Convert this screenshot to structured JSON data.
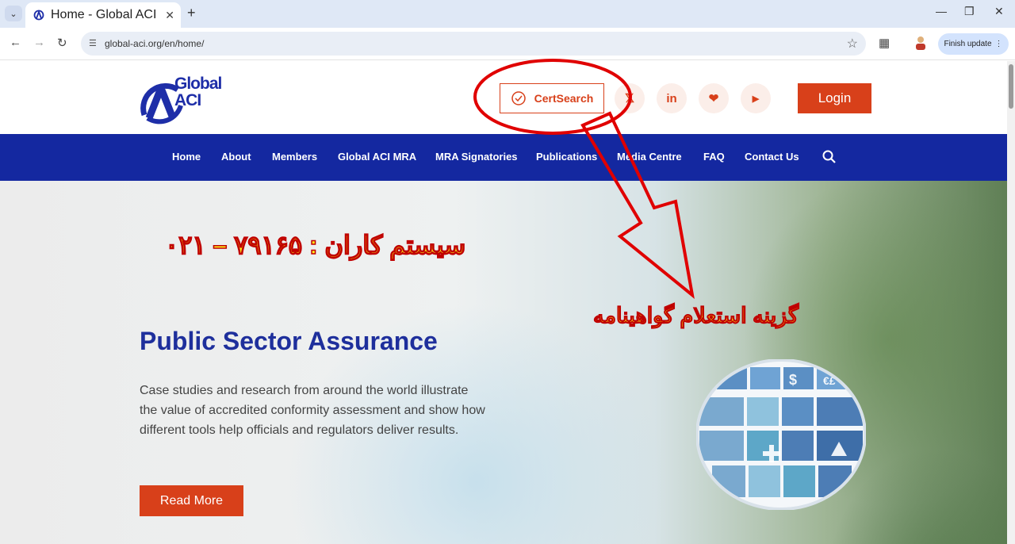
{
  "browser": {
    "tab_title": "Home - Global ACI",
    "url": "global-aci.org/en/home/",
    "finish_update_label": "Finish update",
    "new_tab_glyph": "+",
    "close_glyph": "✕"
  },
  "site": {
    "logo_line1": "Global",
    "logo_line2": "ACI",
    "certsearch_label": "CertSearch",
    "social": [
      {
        "icon": "x-icon",
        "glyph": "𝕏"
      },
      {
        "icon": "linkedin-icon",
        "glyph": "in"
      },
      {
        "icon": "bluesky-icon",
        "glyph": "❤"
      },
      {
        "icon": "youtube-icon",
        "glyph": "▶"
      }
    ],
    "login_label": "Login",
    "nav": [
      "Home",
      "About",
      "Members",
      "Global ACI MRA",
      "MRA Signatories",
      "Publications",
      "Media Centre",
      "FAQ",
      "Contact Us"
    ]
  },
  "hero": {
    "title": "Public Sector Assurance",
    "text": "Case studies and research from around the world illustrate the value of accredited conformity assessment and show how different tools help officials and regulators deliver results.",
    "read_more_label": "Read More"
  },
  "annotations": {
    "phone": "سیستم کاران : ۷۹۱۶۵ – ۰۲۱",
    "option": "گزینه استعلام گواهینامه"
  },
  "colors": {
    "brand_blue": "#1428a0",
    "accent_orange": "#d8401a",
    "annotation_red": "#e00000",
    "annotation_yellow": "#fff21a"
  }
}
